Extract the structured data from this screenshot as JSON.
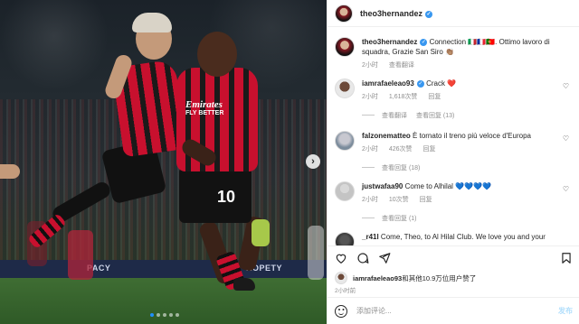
{
  "post": {
    "author": "theo3hernandez",
    "caption_author": "theo3hernandez",
    "caption_text": "Connection 🇮🇹🇫🇷🇵🇹. Ottimo lavoro di squadra, Grazie San Siro 👏🏽",
    "caption_time": "2小时",
    "caption_translate": "查看翻译"
  },
  "photo": {
    "jersey_sponsor": "Emirates",
    "jersey_sponsor_line2": "FLY BETTER",
    "jersey_number": "10",
    "adboard_texts": [
      "PACY",
      "ROPETY"
    ],
    "carousel_dots": 5,
    "active_dot": 0
  },
  "comments": [
    {
      "user": "iamrafaeleao93",
      "verified": true,
      "text": "Crack ❤️",
      "time": "2小时",
      "likes": "1,618次赞",
      "reply": "回复",
      "translate": "查看翻译",
      "view_replies": "查看回复 (13)"
    },
    {
      "user": "falzonematteo",
      "verified": false,
      "text": "È tornato il treno più veloce d'Europa",
      "time": "2小时",
      "likes": "426次赞",
      "reply": "回复",
      "translate": "",
      "view_replies": "查看回复 (18)"
    },
    {
      "user": "justwafaa90",
      "verified": false,
      "text": "Come to Alhilal 💙💙💙💙",
      "time": "2小时",
      "likes": "10次赞",
      "reply": "回复",
      "translate": "",
      "view_replies": "查看回复 (1)"
    },
    {
      "user": "_r41l",
      "verified": false,
      "text": "Come, Theo, to Al Hilal Club. We love you and your",
      "time": "",
      "likes": "",
      "reply": "",
      "translate": "",
      "view_replies": ""
    }
  ],
  "likes": {
    "liker": "iamrafaeleao93",
    "text": "和其他10.9万位用户赞了",
    "time": "2小时前"
  },
  "compose": {
    "placeholder": "添加评论...",
    "post_label": "发布"
  },
  "icons": [
    "heart-icon",
    "comment-icon",
    "share-icon",
    "bookmark-icon",
    "emoji-icon",
    "next-arrow-icon"
  ]
}
